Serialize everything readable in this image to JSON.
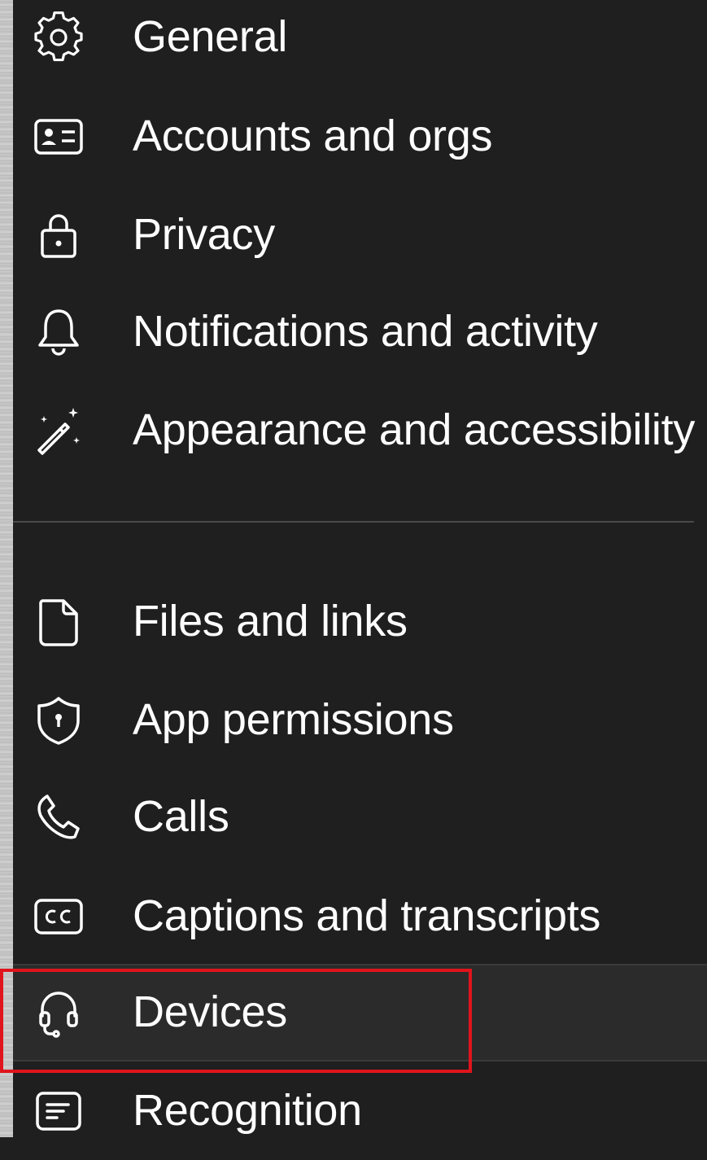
{
  "settings_nav": {
    "items": [
      {
        "label": "General",
        "icon": "gear-icon"
      },
      {
        "label": "Accounts and orgs",
        "icon": "id-card-icon"
      },
      {
        "label": "Privacy",
        "icon": "lock-icon"
      },
      {
        "label": "Notifications and activity",
        "icon": "bell-icon"
      },
      {
        "label": "Appearance and accessibility",
        "icon": "magic-wand-icon"
      },
      {
        "label": "Files and links",
        "icon": "file-icon"
      },
      {
        "label": "App permissions",
        "icon": "shield-icon"
      },
      {
        "label": "Calls",
        "icon": "phone-icon"
      },
      {
        "label": "Captions and transcripts",
        "icon": "closed-captions-icon"
      },
      {
        "label": "Devices",
        "icon": "headset-icon",
        "selected": true
      },
      {
        "label": "Recognition",
        "icon": "recognition-icon"
      }
    ]
  },
  "colors": {
    "panel_background": "#1f1f1f",
    "selected_background": "#2b2b2b",
    "text": "#ffffff",
    "icon_stroke": "#ffffff",
    "highlight_border": "#e0141c"
  }
}
